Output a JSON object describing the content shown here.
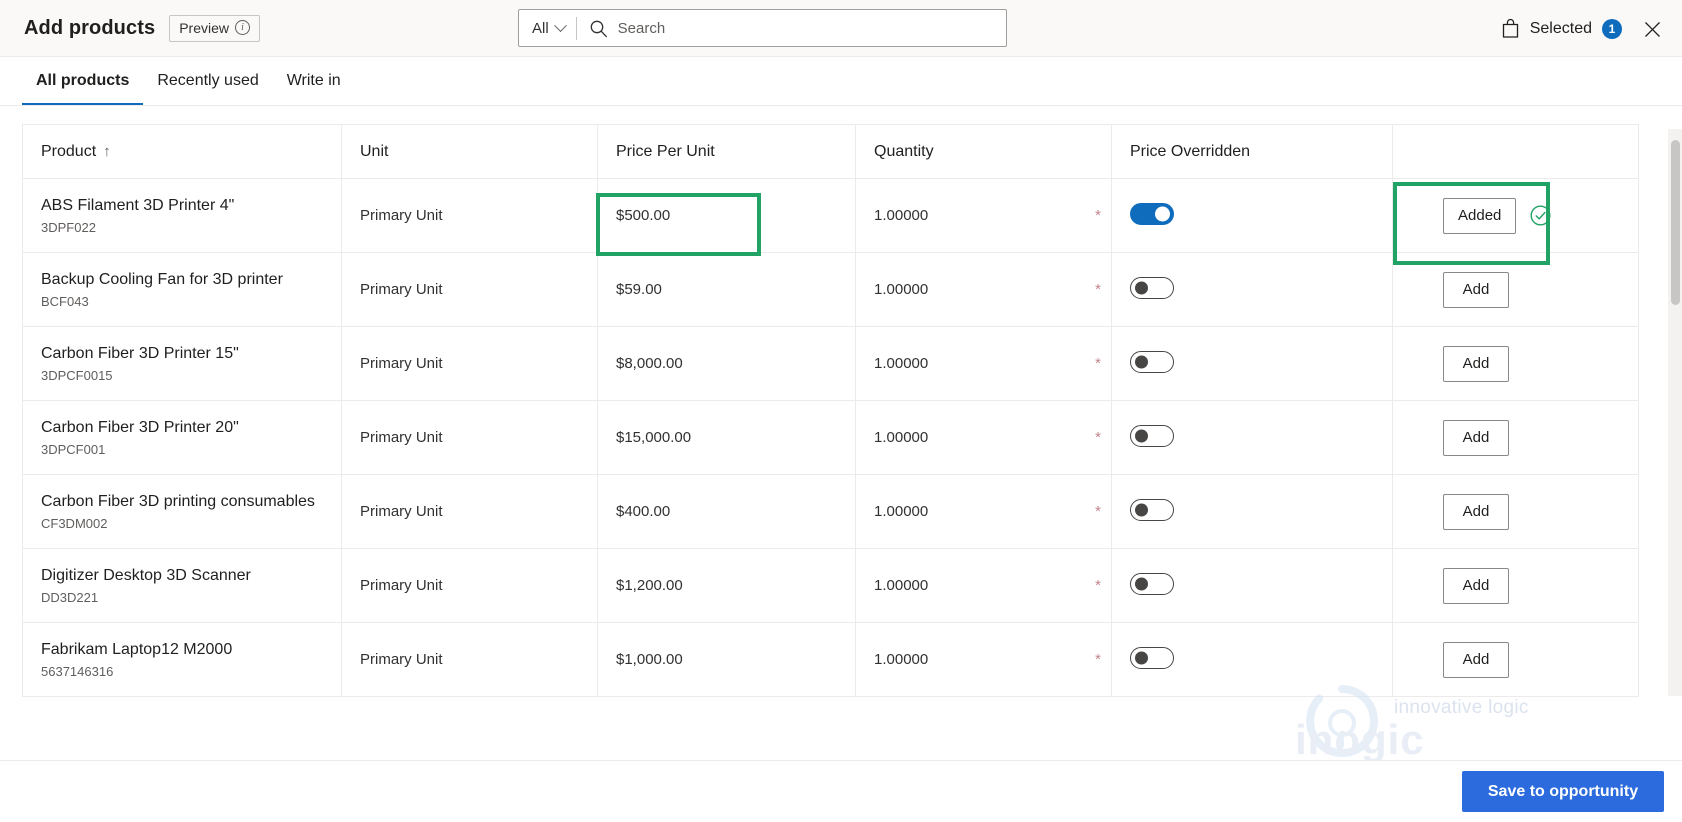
{
  "header": {
    "title": "Add products",
    "preview_label": "Preview",
    "info_icon": "info-icon",
    "selected_label": "Selected",
    "selected_count": "1",
    "bag_icon": "shopping-bag-icon",
    "close_icon": "close-icon"
  },
  "search": {
    "scope_value": "All",
    "placeholder": "Search",
    "value": "",
    "icon": "search-icon",
    "chevron": "chevron-down-icon"
  },
  "tabs": [
    {
      "label": "All products",
      "active": true
    },
    {
      "label": "Recently used",
      "active": false
    },
    {
      "label": "Write in",
      "active": false
    }
  ],
  "table": {
    "columns": [
      {
        "label": "Product",
        "sort": "↑"
      },
      {
        "label": "Unit"
      },
      {
        "label": "Price Per Unit"
      },
      {
        "label": "Quantity"
      },
      {
        "label": "Price Overridden"
      },
      {
        "label": ""
      }
    ],
    "rows": [
      {
        "product": "ABS Filament 3D Printer 4\"",
        "sku": "3DPF022",
        "unit": "Primary Unit",
        "price": "$500.00",
        "quantity": "1.00000",
        "required_marker": "*",
        "price_overridden": true,
        "action_label": "Added",
        "added": true
      },
      {
        "product": "Backup Cooling Fan for 3D printer",
        "sku": "BCF043",
        "unit": "Primary Unit",
        "price": "$59.00",
        "quantity": "1.00000",
        "required_marker": "*",
        "price_overridden": false,
        "action_label": "Add",
        "added": false
      },
      {
        "product": "Carbon Fiber 3D Printer 15\"",
        "sku": "3DPCF0015",
        "unit": "Primary Unit",
        "price": "$8,000.00",
        "quantity": "1.00000",
        "required_marker": "*",
        "price_overridden": false,
        "action_label": "Add",
        "added": false
      },
      {
        "product": "Carbon Fiber 3D Printer 20\"",
        "sku": "3DPCF001",
        "unit": "Primary Unit",
        "price": "$15,000.00",
        "quantity": "1.00000",
        "required_marker": "*",
        "price_overridden": false,
        "action_label": "Add",
        "added": false
      },
      {
        "product": "Carbon Fiber 3D printing consumables",
        "sku": "CF3DM002",
        "unit": "Primary Unit",
        "price": "$400.00",
        "quantity": "1.00000",
        "required_marker": "*",
        "price_overridden": false,
        "action_label": "Add",
        "added": false
      },
      {
        "product": "Digitizer Desktop 3D Scanner",
        "sku": "DD3D221",
        "unit": "Primary Unit",
        "price": "$1,200.00",
        "quantity": "1.00000",
        "required_marker": "*",
        "price_overridden": false,
        "action_label": "Add",
        "added": false
      },
      {
        "product": "Fabrikam Laptop12 M2000",
        "sku": "5637146316",
        "unit": "Primary Unit",
        "price": "$1,000.00",
        "quantity": "1.00000",
        "required_marker": "*",
        "price_overridden": false,
        "action_label": "Add",
        "added": false
      }
    ]
  },
  "watermark": {
    "tagline": "innovative logic",
    "brand": "inogic"
  },
  "footer": {
    "save_label": "Save to opportunity"
  },
  "colors": {
    "accent": "#0f6cbd",
    "save_button": "#2b6bdd",
    "highlight": "#21a366",
    "success": "#21a366",
    "required": "#c4848b"
  }
}
